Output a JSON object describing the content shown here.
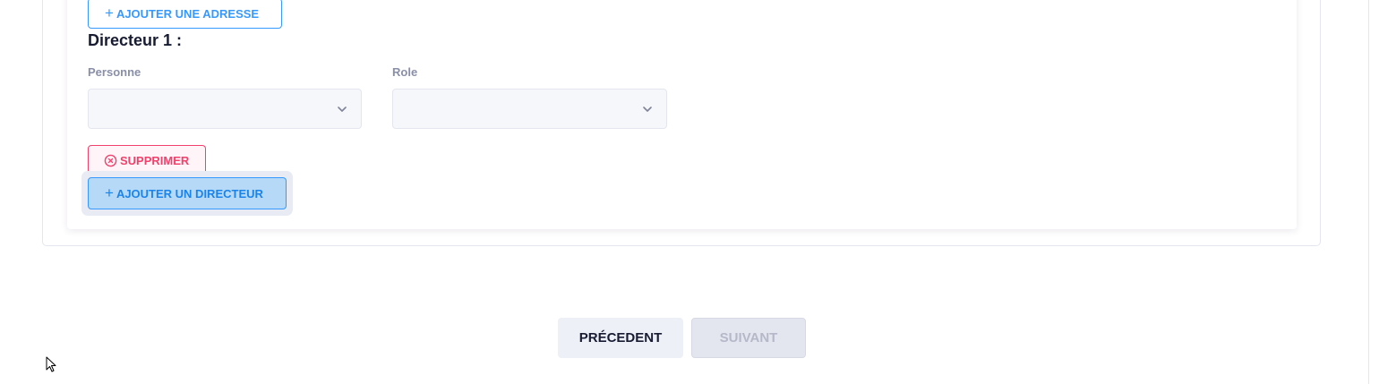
{
  "address": {
    "add_label": "AJOUTER UNE ADRESSE"
  },
  "director": {
    "title": "Directeur 1 :",
    "person_label": "Personne",
    "person_value": "",
    "role_label": "Role",
    "role_value": "",
    "delete_label": "SUPPRIMER",
    "add_label": "AJOUTER UN DIRECTEUR"
  },
  "navigation": {
    "prev_label": "PRÉCEDENT",
    "next_label": "SUIVANT"
  },
  "icons": {
    "plus": "plus-icon",
    "chevron": "chevron-down-icon",
    "delete": "close-circle-icon"
  },
  "colors": {
    "primary": "#3699ff",
    "danger": "#f1416c",
    "text_dark": "#181c32",
    "label_muted": "#8a8fa8"
  }
}
